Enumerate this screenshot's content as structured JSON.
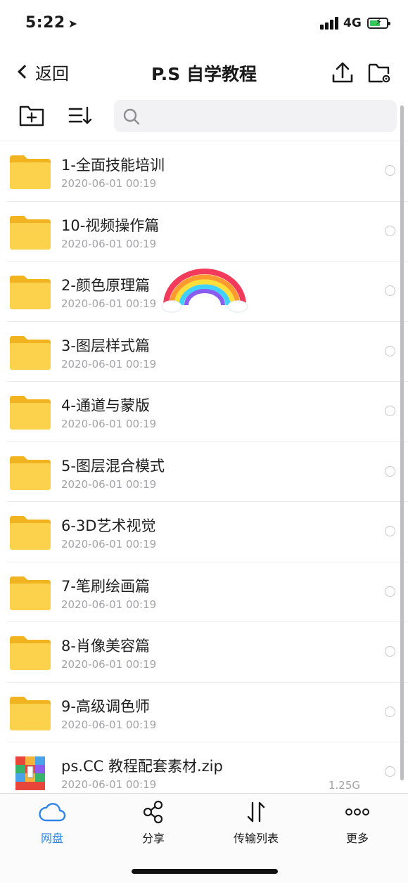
{
  "status": {
    "time": "5:22",
    "network": "4G"
  },
  "nav": {
    "back_label": "返回",
    "title": "P.S 自学教程"
  },
  "search": {
    "placeholder": ""
  },
  "files": [
    {
      "name": "1-全面技能培训",
      "date": "2020-06-01 00:19",
      "type": "folder"
    },
    {
      "name": "10-视频操作篇",
      "date": "2020-06-01 00:19",
      "type": "folder"
    },
    {
      "name": "2-颜色原理篇",
      "date": "2020-06-01 00:19",
      "type": "folder"
    },
    {
      "name": "3-图层样式篇",
      "date": "2020-06-01 00:19",
      "type": "folder"
    },
    {
      "name": "4-通道与蒙版",
      "date": "2020-06-01 00:19",
      "type": "folder"
    },
    {
      "name": "5-图层混合模式",
      "date": "2020-06-01 00:19",
      "type": "folder"
    },
    {
      "name": "6-3D艺术视觉",
      "date": "2020-06-01 00:19",
      "type": "folder"
    },
    {
      "name": "7-笔刷绘画篇",
      "date": "2020-06-01 00:19",
      "type": "folder"
    },
    {
      "name": "8-肖像美容篇",
      "date": "2020-06-01 00:19",
      "type": "folder"
    },
    {
      "name": "9-高级调色师",
      "date": "2020-06-01 00:19",
      "type": "folder"
    },
    {
      "name": "ps.CC 教程配套素材.zip",
      "date": "2020-06-01 00:19",
      "size": "1.25G",
      "type": "zip"
    }
  ],
  "tabs": [
    {
      "label": "网盘",
      "icon": "cloud-icon",
      "active": true
    },
    {
      "label": "分享",
      "icon": "share-icon",
      "active": false
    },
    {
      "label": "传输列表",
      "icon": "transfer-icon",
      "active": false
    },
    {
      "label": "更多",
      "icon": "more-icon",
      "active": false
    }
  ],
  "colors": {
    "folder": "#fbc62f",
    "accent": "#2f86ea",
    "battery": "#34c759"
  }
}
